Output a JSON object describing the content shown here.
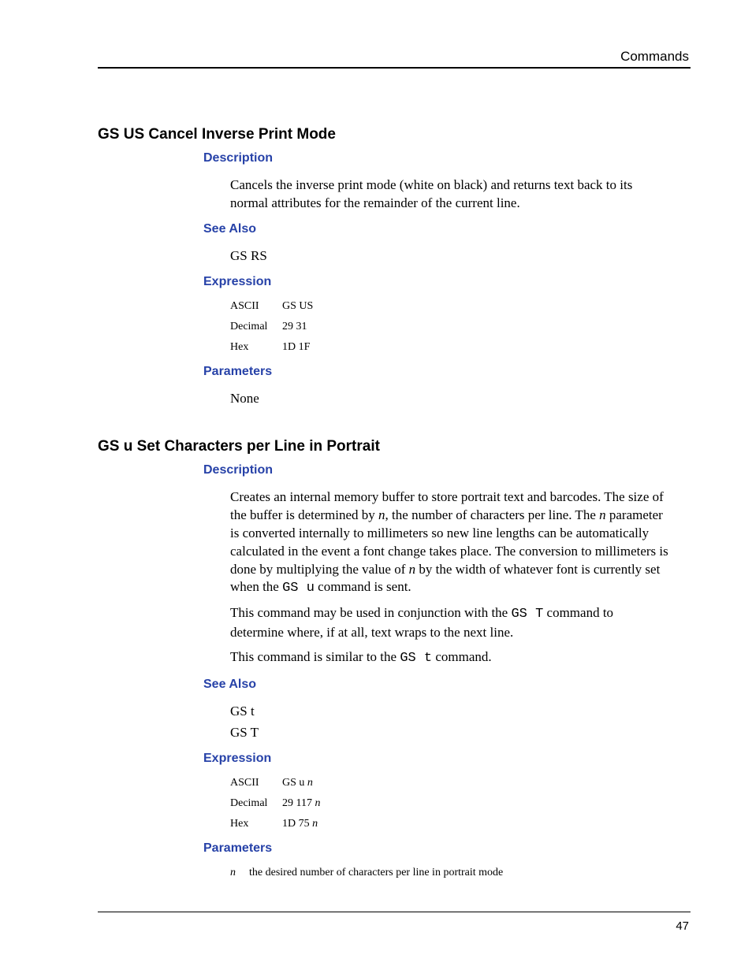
{
  "header": {
    "section": "Commands"
  },
  "footer": {
    "page_number": "47"
  },
  "commands": [
    {
      "title": "GS US Cancel Inverse Print Mode",
      "headings": {
        "description": "Description",
        "see_also": "See Also",
        "expression": "Expression",
        "parameters": "Parameters"
      },
      "description": [
        "Cancels the inverse print mode (white on black) and returns text back to its normal attributes for the remainder of the current line."
      ],
      "see_also": [
        "GS RS"
      ],
      "expression": {
        "ascii": {
          "label": "ASCII",
          "value": "GS US"
        },
        "decimal": {
          "label": "Decimal",
          "value": "29 31"
        },
        "hex": {
          "label": "Hex",
          "value": "1D 1F"
        }
      },
      "parameters_text": "None"
    },
    {
      "title": "GS u Set Characters per Line in Portrait",
      "headings": {
        "description": "Description",
        "see_also": "See Also",
        "expression": "Expression",
        "parameters": "Parameters"
      },
      "description_parts": {
        "p1_a": "Creates an internal memory buffer to store portrait text and barcodes. The size of the buffer is determined by ",
        "p1_n1": "n",
        "p1_b": ", the number of characters per line. The ",
        "p1_n2": "n",
        "p1_c": " parameter is converted internally to millimeters so new line lengths can be automatically calculated in the event a font change takes place. The conversion to millimeters is done by multiplying the value of ",
        "p1_n3": "n",
        "p1_d": " by the width of whatever font is currently set when the ",
        "p1_code": "GS u",
        "p1_e": " command is sent.",
        "p2_a": "This command may be used in conjunction with the ",
        "p2_code": "GS T",
        "p2_b": " command to determine where, if at all, text wraps to the next line.",
        "p3_a": "This command is similar to the ",
        "p3_code": "GS t",
        "p3_b": " command."
      },
      "see_also": [
        "GS t",
        "GS T"
      ],
      "expression": {
        "ascii": {
          "label": "ASCII",
          "value_prefix": "GS u ",
          "n": "n"
        },
        "decimal": {
          "label": "Decimal",
          "value_prefix": "29 117 ",
          "n": "n"
        },
        "hex": {
          "label": "Hex",
          "value_prefix": "1D 75 ",
          "n": "n"
        }
      },
      "parameters": [
        {
          "name": "n",
          "desc": "the desired number of characters per line in portrait mode"
        }
      ]
    }
  ]
}
